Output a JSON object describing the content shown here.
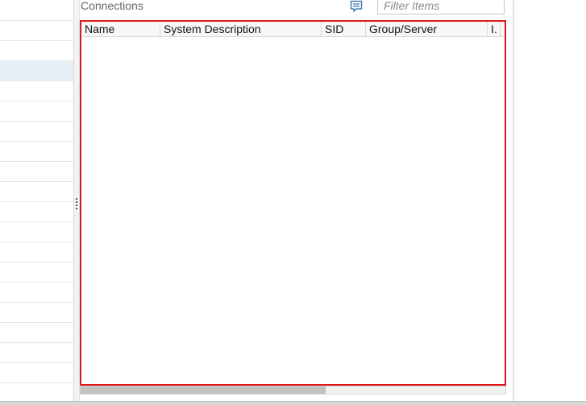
{
  "panel": {
    "title": "Connections",
    "comment_icon": "comment-icon",
    "filter": {
      "value": "",
      "placeholder": "Filter Items"
    }
  },
  "table": {
    "columns": [
      "Name",
      "System Description",
      "SID",
      "Group/Server",
      "I."
    ],
    "rows": []
  },
  "left_list": {
    "selected_index": 3
  },
  "colors": {
    "highlight_border": "#e0161b",
    "selected_row": "#e8eef6",
    "header_bg": "#f7f7f7",
    "icon_blue": "#2b6cb0"
  }
}
